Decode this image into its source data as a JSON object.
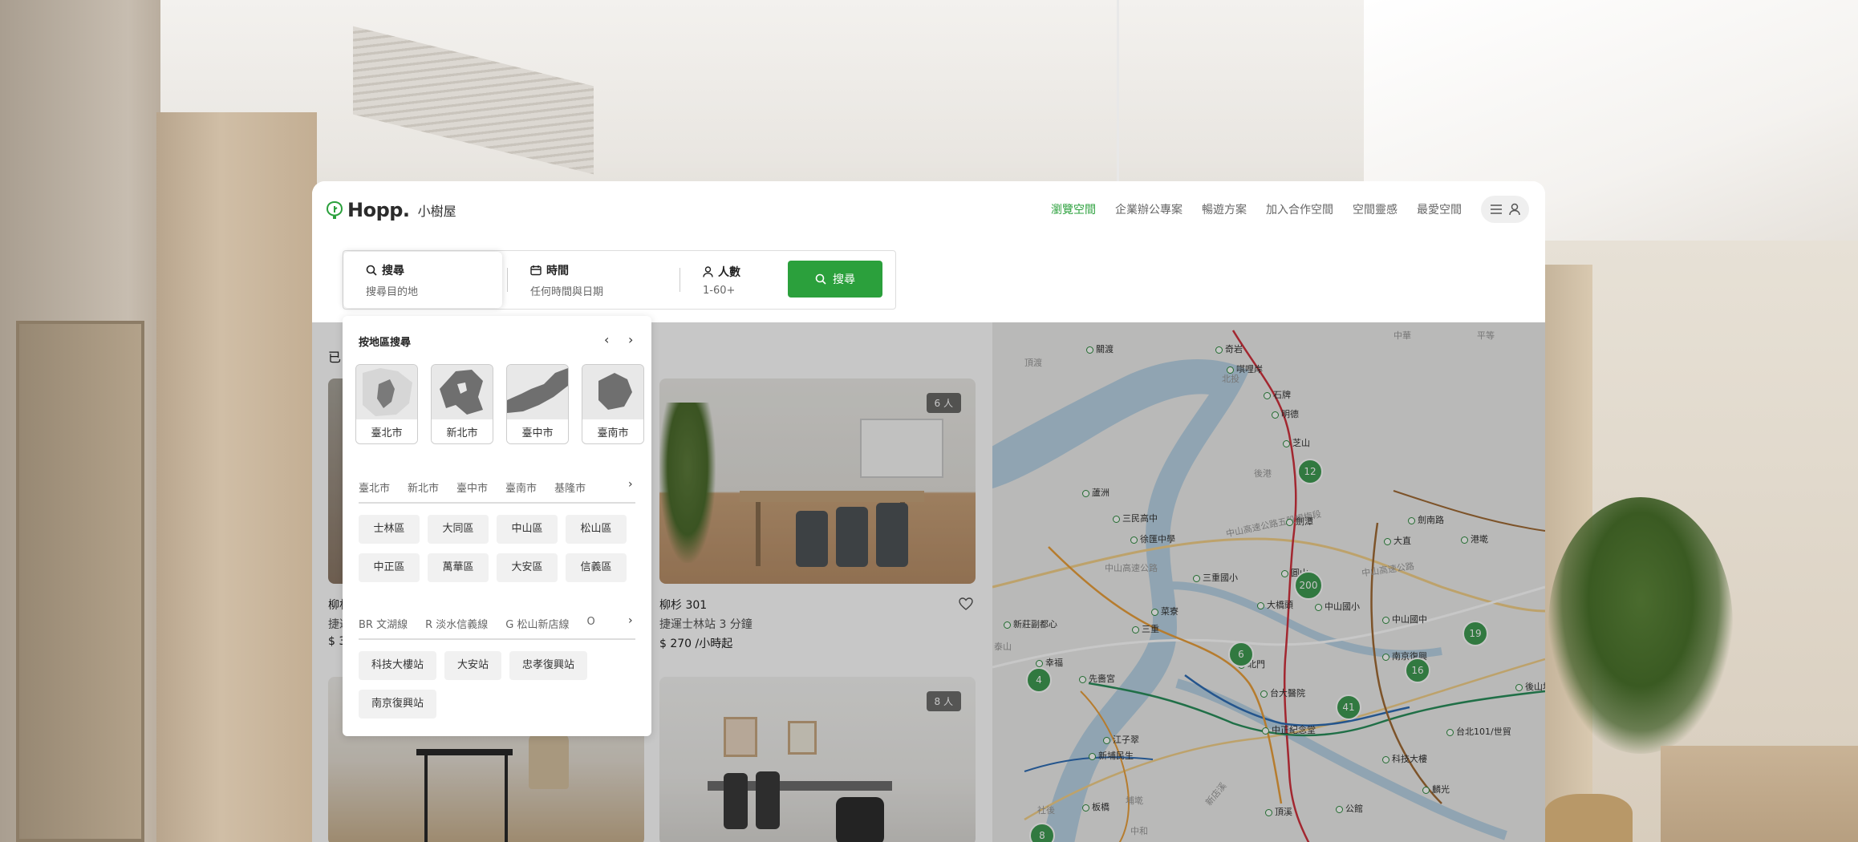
{
  "brand": {
    "name": "Hopp.",
    "subtitle": "小樹屋",
    "accent": "#2ba03c"
  },
  "nav": {
    "items": [
      {
        "label": "瀏覽空間",
        "active": true
      },
      {
        "label": "企業辦公專案",
        "active": false
      },
      {
        "label": "暢遊方案",
        "active": false
      },
      {
        "label": "加入合作空間",
        "active": false
      },
      {
        "label": "空間靈感",
        "active": false
      },
      {
        "label": "最愛空間",
        "active": false
      }
    ],
    "menu_icons": [
      "hamburger-icon",
      "user-icon"
    ]
  },
  "search": {
    "where_label": "搜尋",
    "where_value": "搜尋目的地",
    "when_label": "時間",
    "when_value": "任何時間與日期",
    "guests_label": "人數",
    "guests_value": "1-60+",
    "button_label": "搜尋"
  },
  "dropdown": {
    "title": "按地區搜尋",
    "cities": [
      "臺北市",
      "新北市",
      "臺中市",
      "臺南市"
    ],
    "city_tabs": [
      "臺北市",
      "新北市",
      "臺中市",
      "臺南市",
      "基隆市"
    ],
    "districts": [
      "士林區",
      "大同區",
      "中山區",
      "松山區",
      "中正區",
      "萬華區",
      "大安區",
      "信義區"
    ],
    "metro_tabs": [
      "BR 文湖線",
      "R 淡水信義線",
      "G 松山新店線",
      "O"
    ],
    "stations": [
      "科技大樓站",
      "大安站",
      "忠孝復興站",
      "南京復興站"
    ]
  },
  "listings": [
    {
      "title": "柳杉 301",
      "subtitle": "捷運士林站 3 分鐘",
      "price": "$ 270 /小時起",
      "capacity": "6 人"
    },
    {
      "capacity": "8 人"
    }
  ],
  "listing_partial": {
    "title": "柳杉",
    "subtitle": "捷運",
    "price": "$ 3",
    "heading": "已"
  },
  "map": {
    "pins": [
      "12",
      "200",
      "6",
      "4",
      "41",
      "16",
      "19",
      "8"
    ],
    "stations": [
      "關渡",
      "奇岩",
      "唭哩岸",
      "石牌",
      "明德",
      "芝山",
      "蘆洲",
      "三民高中",
      "徐匯中學",
      "劍潭",
      "三重國小",
      "圓山",
      "大橋頭",
      "中山國小",
      "菜寮",
      "三重",
      "新莊副都心",
      "幸福",
      "先嗇宮",
      "北門",
      "台大醫院",
      "中正紀念堂",
      "江子翠",
      "新埔民生",
      "板橋",
      "頂溪",
      "公館",
      "科技大樓",
      "南京復興",
      "中山國中",
      "大直",
      "劍南路",
      "港墘",
      "台北101/世貿",
      "後山埤",
      "麟光"
    ],
    "areas": [
      "頂渡",
      "平等",
      "後港",
      "中山高速公路",
      "泰山",
      "社後",
      "埔墘",
      "中華",
      "中和",
      "北投",
      "中山高速公路五股楊梅段",
      "中山高速公路",
      "新店溪"
    ]
  }
}
